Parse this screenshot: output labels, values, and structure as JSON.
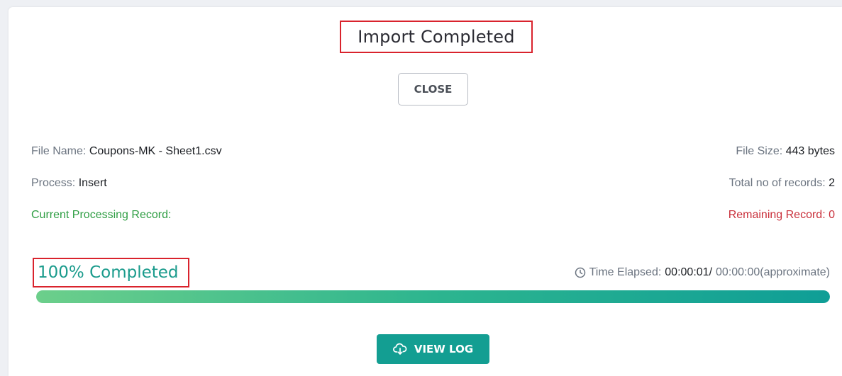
{
  "dialog": {
    "title": "Import Completed",
    "close_label": "CLOSE"
  },
  "info": {
    "file_name_label": "File Name:",
    "file_name": "Coupons-MK - Sheet1.csv",
    "file_size_label": "File Size:",
    "file_size": "443 bytes",
    "process_label": "Process:",
    "process": "Insert",
    "total_records_label": "Total no of records:",
    "total_records": "2",
    "current_record_label": "Current Processing Record:",
    "current_record": "",
    "remaining_label": "Remaining Record:",
    "remaining": "0"
  },
  "progress": {
    "percent_text": "100% Completed",
    "fraction": 1.0,
    "time_elapsed_label": "Time Elapsed:",
    "time_elapsed": "00:00:01/",
    "time_estimate": "00:00:00(approximate)"
  },
  "actions": {
    "view_log_label": "VIEW LOG",
    "view_log_icon": "cloud-download-icon"
  },
  "colors": {
    "accent": "#139e92",
    "success": "#2f9e44",
    "danger": "#c9303b",
    "highlight_border": "#d9232d"
  }
}
